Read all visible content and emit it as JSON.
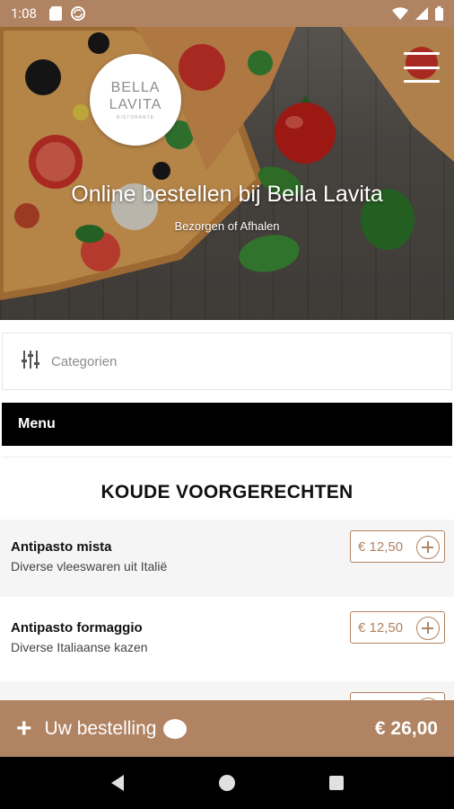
{
  "status_bar": {
    "time": "1:08",
    "icons_left": [
      "sd-card-icon",
      "sync-icon"
    ],
    "icons_right": [
      "wifi-icon",
      "signal-icon",
      "battery-icon"
    ]
  },
  "hero": {
    "logo_line1": "BELLA",
    "logo_line2": "LAVITA",
    "logo_sub": "RISTORANTE",
    "title": "Online bestellen bij Bella Lavita",
    "subtitle": "Bezorgen of Afhalen"
  },
  "categories": {
    "label": "Categorien"
  },
  "menu": {
    "header": "Menu",
    "section_title": "KOUDE VOORGERECHTEN",
    "items": [
      {
        "name": "Antipasto mista",
        "description": "Diverse vleeswaren uit Italië",
        "price": "€ 12,50"
      },
      {
        "name": "Antipasto formaggio",
        "description": "Diverse Italiaanse kazen",
        "price": "€ 12,50"
      }
    ]
  },
  "order": {
    "label": "Uw bestelling",
    "total": "€ 26,00"
  },
  "colors": {
    "accent": "#b08363",
    "menu_header_bg": "#000000"
  }
}
